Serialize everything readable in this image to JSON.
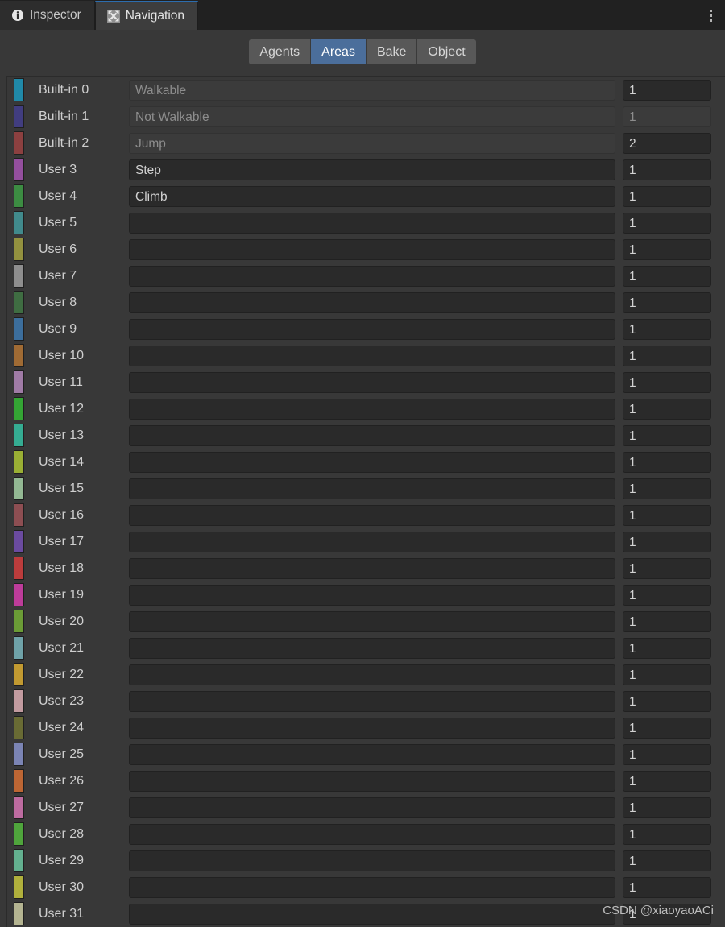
{
  "window": {
    "tabs": [
      {
        "label": "Inspector",
        "icon": "info-icon",
        "active": false
      },
      {
        "label": "Navigation",
        "icon": "move-arrows-icon",
        "active": true
      }
    ],
    "menu_icon": "kebab-menu-icon"
  },
  "toolbar": {
    "buttons": [
      {
        "label": "Agents",
        "active": false
      },
      {
        "label": "Areas",
        "active": true
      },
      {
        "label": "Bake",
        "active": false
      },
      {
        "label": "Object",
        "active": false
      }
    ],
    "active_color": "#4b6e9b",
    "inactive_color": "#585858"
  },
  "areas": {
    "rows": [
      {
        "label": "Built-in 0",
        "color": "#2089a8",
        "name": "Walkable",
        "name_disabled": true,
        "cost": "1",
        "cost_disabled": false
      },
      {
        "label": "Built-in 1",
        "color": "#413d80",
        "name": "Not Walkable",
        "name_disabled": true,
        "cost": "1",
        "cost_disabled": true
      },
      {
        "label": "Built-in 2",
        "color": "#8c4040",
        "name": "Jump",
        "name_disabled": true,
        "cost": "2",
        "cost_disabled": false
      },
      {
        "label": "User 3",
        "color": "#944f9e",
        "name": "Step",
        "name_disabled": false,
        "cost": "1",
        "cost_disabled": false
      },
      {
        "label": "User 4",
        "color": "#3c8c42",
        "name": "Climb",
        "name_disabled": false,
        "cost": "1",
        "cost_disabled": false
      },
      {
        "label": "User 5",
        "color": "#418a8c",
        "name": "",
        "name_disabled": false,
        "cost": "1",
        "cost_disabled": false
      },
      {
        "label": "User 6",
        "color": "#93913f",
        "name": "",
        "name_disabled": false,
        "cost": "1",
        "cost_disabled": false
      },
      {
        "label": "User 7",
        "color": "#8e8e8e",
        "name": "",
        "name_disabled": false,
        "cost": "1",
        "cost_disabled": false
      },
      {
        "label": "User 8",
        "color": "#3f6d42",
        "name": "",
        "name_disabled": false,
        "cost": "1",
        "cost_disabled": false
      },
      {
        "label": "User 9",
        "color": "#3c6e9c",
        "name": "",
        "name_disabled": false,
        "cost": "1",
        "cost_disabled": false
      },
      {
        "label": "User 10",
        "color": "#a06b34",
        "name": "",
        "name_disabled": false,
        "cost": "1",
        "cost_disabled": false
      },
      {
        "label": "User 11",
        "color": "#a07ba6",
        "name": "",
        "name_disabled": false,
        "cost": "1",
        "cost_disabled": false
      },
      {
        "label": "User 12",
        "color": "#34a534",
        "name": "",
        "name_disabled": false,
        "cost": "1",
        "cost_disabled": false
      },
      {
        "label": "User 13",
        "color": "#35ac92",
        "name": "",
        "name_disabled": false,
        "cost": "1",
        "cost_disabled": false
      },
      {
        "label": "User 14",
        "color": "#9aaf34",
        "name": "",
        "name_disabled": false,
        "cost": "1",
        "cost_disabled": false
      },
      {
        "label": "User 15",
        "color": "#93b893",
        "name": "",
        "name_disabled": false,
        "cost": "1",
        "cost_disabled": false
      },
      {
        "label": "User 16",
        "color": "#8d4e52",
        "name": "",
        "name_disabled": false,
        "cost": "1",
        "cost_disabled": false
      },
      {
        "label": "User 17",
        "color": "#6b4ba0",
        "name": "",
        "name_disabled": false,
        "cost": "1",
        "cost_disabled": false
      },
      {
        "label": "User 18",
        "color": "#bc3c3c",
        "name": "",
        "name_disabled": false,
        "cost": "1",
        "cost_disabled": false
      },
      {
        "label": "User 19",
        "color": "#bd3c9a",
        "name": "",
        "name_disabled": false,
        "cost": "1",
        "cost_disabled": false
      },
      {
        "label": "User 20",
        "color": "#6b9c36",
        "name": "",
        "name_disabled": false,
        "cost": "1",
        "cost_disabled": false
      },
      {
        "label": "User 21",
        "color": "#6fa2a8",
        "name": "",
        "name_disabled": false,
        "cost": "1",
        "cost_disabled": false
      },
      {
        "label": "User 22",
        "color": "#c29a31",
        "name": "",
        "name_disabled": false,
        "cost": "1",
        "cost_disabled": false
      },
      {
        "label": "User 23",
        "color": "#c29ba0",
        "name": "",
        "name_disabled": false,
        "cost": "1",
        "cost_disabled": false
      },
      {
        "label": "User 24",
        "color": "#696b34",
        "name": "",
        "name_disabled": false,
        "cost": "1",
        "cost_disabled": false
      },
      {
        "label": "User 25",
        "color": "#7b84b4",
        "name": "",
        "name_disabled": false,
        "cost": "1",
        "cost_disabled": false
      },
      {
        "label": "User 26",
        "color": "#bd6634",
        "name": "",
        "name_disabled": false,
        "cost": "1",
        "cost_disabled": false
      },
      {
        "label": "User 27",
        "color": "#bd6ba0",
        "name": "",
        "name_disabled": false,
        "cost": "1",
        "cost_disabled": false
      },
      {
        "label": "User 28",
        "color": "#4fa53c",
        "name": "",
        "name_disabled": false,
        "cost": "1",
        "cost_disabled": false
      },
      {
        "label": "User 29",
        "color": "#63b08f",
        "name": "",
        "name_disabled": false,
        "cost": "1",
        "cost_disabled": false
      },
      {
        "label": "User 30",
        "color": "#b0b03c",
        "name": "",
        "name_disabled": false,
        "cost": "1",
        "cost_disabled": false
      },
      {
        "label": "User 31",
        "color": "#b4b491",
        "name": "",
        "name_disabled": false,
        "cost": "1",
        "cost_disabled": false
      }
    ]
  },
  "watermark": {
    "text": "CSDN @xiaoyaoACi"
  }
}
